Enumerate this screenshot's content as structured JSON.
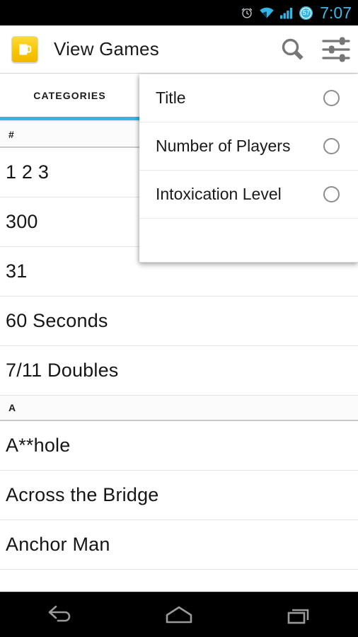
{
  "status_bar": {
    "time": "7:07",
    "battery_level": "57",
    "icons": [
      "alarm-clock-icon",
      "wifi-icon",
      "signal-bars-icon",
      "battery-icon"
    ],
    "time_color": "#33b5e5",
    "background": "#000000"
  },
  "action_bar": {
    "app_icon": "beer-mug-icon",
    "title": "View Games",
    "actions": [
      {
        "name": "search-icon",
        "label": "Search"
      },
      {
        "name": "sort-settings-icon",
        "label": "Sort"
      }
    ]
  },
  "tabs": {
    "active_index": 0,
    "indicator_color": "#33b5e5",
    "items": [
      {
        "label": "CATEGORIES"
      }
    ]
  },
  "sort_dropdown": {
    "visible": true,
    "options": [
      {
        "label": "Title",
        "selected": false
      },
      {
        "label": "Number of Players",
        "selected": false
      },
      {
        "label": "Intoxication Level",
        "selected": false
      }
    ]
  },
  "game_list": {
    "rows": [
      {
        "type": "section",
        "label": "#"
      },
      {
        "type": "item",
        "label": "1 2 3"
      },
      {
        "type": "item",
        "label": "300"
      },
      {
        "type": "item",
        "label": "31"
      },
      {
        "type": "item",
        "label": "60 Seconds"
      },
      {
        "type": "item",
        "label": "7/11 Doubles"
      },
      {
        "type": "section",
        "label": "A"
      },
      {
        "type": "item",
        "label": "A**hole"
      },
      {
        "type": "item",
        "label": "Across the Bridge"
      },
      {
        "type": "item",
        "label": "Anchor Man"
      },
      {
        "type": "item",
        "label": ""
      }
    ]
  },
  "nav_bar": {
    "buttons": [
      {
        "name": "back-button",
        "label": "Back"
      },
      {
        "name": "home-button",
        "label": "Home"
      },
      {
        "name": "recents-button",
        "label": "Recent apps"
      }
    ]
  }
}
